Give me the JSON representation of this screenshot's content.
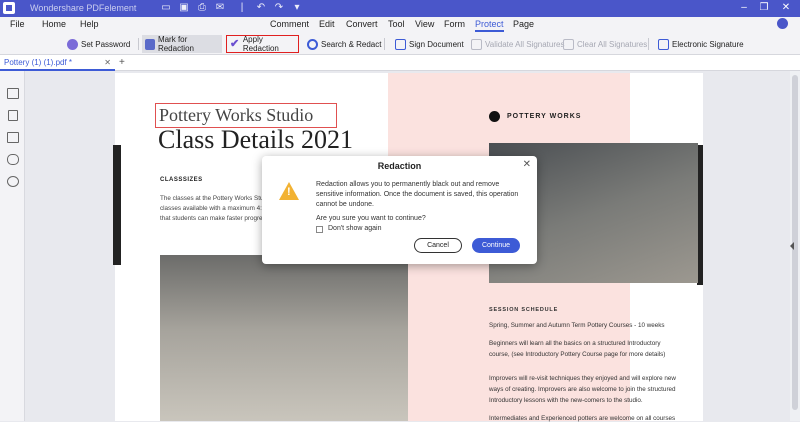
{
  "app": {
    "name": "Wondershare PDFelement",
    "title_icons": [
      "folder-icon",
      "save-icon",
      "print-icon",
      "email-icon",
      "undo-icon",
      "redo-icon",
      "dropdown-icon"
    ],
    "window_controls": [
      "minimize-icon",
      "restore-icon",
      "close-icon"
    ]
  },
  "menu": {
    "left": [
      "File",
      "Home",
      "Help"
    ],
    "main": [
      "Comment",
      "Edit",
      "Convert",
      "Tool",
      "View",
      "Form",
      "Protect",
      "Page"
    ],
    "active": "Protect"
  },
  "toolbar": {
    "set_password": "Set Password",
    "mark_for_redaction": "Mark for Redaction",
    "apply_redaction": "Apply Redaction",
    "search_redact": "Search & Redact",
    "sign_document": "Sign Document",
    "validate_all_signatures": "Validate All Signatures",
    "clear_all_signatures": "Clear All Signatures",
    "electronic_signature": "Electronic Signature"
  },
  "tab": {
    "label": "Pottery (1) (1).pdf *",
    "add": "+"
  },
  "document": {
    "subtitle": "Pottery Works Studio",
    "title": "Class Details 2021",
    "class_sizes_heading": "CLASSSIZES",
    "left_lines": [
      "The classes at the Pottery Works Studi",
      "classes available with a maximum 4:1 ra",
      "that students can make faster progress"
    ],
    "brand": "POTTERY WORKS",
    "session_heading": "SESSION SCHEDULE",
    "right_lines": [
      "Spring, Summer and Autumn Term Pottery Courses - 10 weeks",
      "Beginners will learn all the basics on a structured Introductory",
      "course, (see Introductory Pottery Course page for more details)",
      "Improvers will re-visit techniques they enjoyed and will explore new",
      "ways of creating. Improvers are also welcome to join the structured",
      "Introductory lessons with the new-comers to the studio.",
      "Intermediates and Experienced potters are welcome on all courses"
    ]
  },
  "dialog": {
    "title": "Redaction",
    "close": "✕",
    "message_lines": [
      "Redaction allows you to permanently black out and remove",
      "sensitive information. Once the document is saved, this operation",
      "cannot be undone."
    ],
    "question": "Are you sure you want to continue?",
    "checkbox_label": "Don't show again",
    "cancel": "Cancel",
    "continue": "Continue"
  },
  "colors": {
    "titlebar": "#4a56c9",
    "accent": "#3d5bd6",
    "highlight_border": "#e02020",
    "pink_column": "#fbe2df",
    "warning": "#f2b233"
  }
}
